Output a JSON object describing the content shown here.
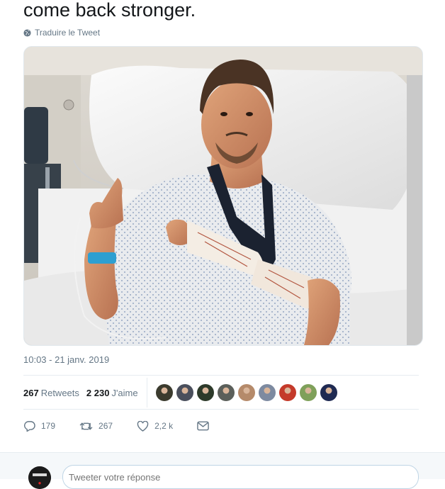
{
  "tweet": {
    "text": "come back stronger.",
    "translate_label": "Traduire le Tweet",
    "timestamp": "10:03 - 21 janv. 2019"
  },
  "photo": {
    "icon": "hospital-photo"
  },
  "stats": {
    "retweets_count": "267",
    "retweets_label": "Retweets",
    "likes_count": "2 230",
    "likes_label": "J'aime",
    "liker_avatar_colors": [
      "#3b3b2e",
      "#4a4f5c",
      "#2d3a2a",
      "#5b5f5a",
      "#b58a6a",
      "#7d8aa0",
      "#c43a2a",
      "#7fa05a",
      "#1f2a52"
    ]
  },
  "actions": {
    "replies": "179",
    "retweets": "267",
    "likes": "2,2 k"
  },
  "reply": {
    "placeholder": "Tweeter votre réponse"
  },
  "colors": {
    "text": "#14171a",
    "secondary": "#657786",
    "border": "#e6ecf0",
    "accent": "#1da1f2"
  }
}
